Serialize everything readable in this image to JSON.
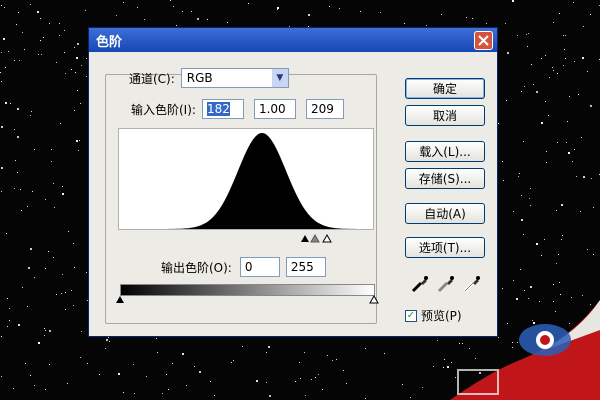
{
  "dialog": {
    "title": "色阶",
    "channel_label": "通道(C):",
    "channel_value": "RGB",
    "input_levels_label": "输入色阶(I):",
    "input_black": "182",
    "input_gamma": "1.00",
    "input_white": "209",
    "output_levels_label": "输出色阶(O):",
    "output_black": "0",
    "output_white": "255",
    "preview_label": "预览(P)",
    "preview_checked": true
  },
  "buttons": {
    "ok": "确定",
    "cancel": "取消",
    "load": "载入(L)...",
    "save": "存储(S)...",
    "auto": "自动(A)",
    "options": "选项(T)..."
  },
  "icons": {
    "close": "close-icon",
    "dropdown": "chevron-down-icon",
    "eyedroppers": [
      "black-eyedropper-icon",
      "gray-eyedropper-icon",
      "white-eyedropper-icon"
    ]
  },
  "colors": {
    "titlebar": "#1747b5",
    "dialog_bg": "#ecebe5",
    "histogram": "#000000",
    "watermark_accent": "#c0161a",
    "watermark_blue": "#2c5fb8"
  },
  "histogram": {
    "description_peak_level": 182,
    "range_min": 0,
    "range_max": 255
  }
}
